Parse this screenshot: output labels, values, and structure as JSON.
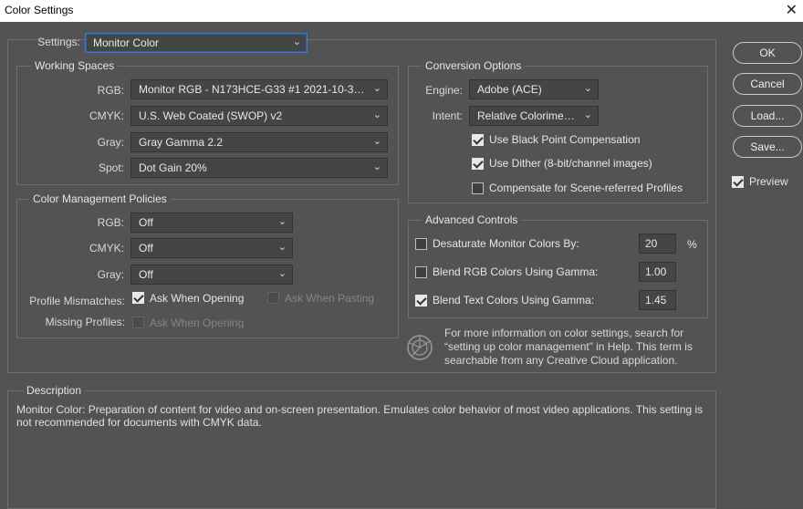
{
  "window": {
    "title": "Color Settings",
    "close_icon": "close-icon"
  },
  "settings": {
    "label": "Settings:",
    "value": "Monitor Color"
  },
  "working_spaces": {
    "title": "Working Spaces",
    "rgb": {
      "label": "RGB:",
      "value": "Monitor RGB - N173HCE-G33 #1 2021-10-31..."
    },
    "cmyk": {
      "label": "CMYK:",
      "value": "U.S. Web Coated (SWOP) v2"
    },
    "gray": {
      "label": "Gray:",
      "value": "Gray Gamma 2.2"
    },
    "spot": {
      "label": "Spot:",
      "value": "Dot Gain 20%"
    }
  },
  "policies": {
    "title": "Color Management Policies",
    "rgb": {
      "label": "RGB:",
      "value": "Off"
    },
    "cmyk": {
      "label": "CMYK:",
      "value": "Off"
    },
    "gray": {
      "label": "Gray:",
      "value": "Off"
    },
    "mismatches_label": "Profile Mismatches:",
    "ask_opening": {
      "label": "Ask When Opening",
      "checked": true
    },
    "ask_pasting": {
      "label": "Ask When Pasting",
      "checked": false,
      "disabled": true
    },
    "missing_label": "Missing Profiles:",
    "missing_ask_opening": {
      "label": "Ask When Opening",
      "checked": false,
      "disabled": true
    }
  },
  "conversion": {
    "title": "Conversion Options",
    "engine": {
      "label": "Engine:",
      "value": "Adobe (ACE)"
    },
    "intent": {
      "label": "Intent:",
      "value": "Relative Colorimetric"
    },
    "black_point": {
      "label": "Use Black Point Compensation",
      "checked": true
    },
    "dither": {
      "label": "Use Dither (8-bit/channel images)",
      "checked": true
    },
    "scene_referred": {
      "label": "Compensate for Scene-referred Profiles",
      "checked": false
    }
  },
  "advanced": {
    "title": "Advanced Controls",
    "desaturate": {
      "label": "Desaturate Monitor Colors By:",
      "checked": false,
      "value": "20",
      "unit": "%"
    },
    "blend_rgb": {
      "label": "Blend RGB Colors Using Gamma:",
      "checked": false,
      "value": "1.00"
    },
    "blend_text": {
      "label": "Blend Text Colors Using Gamma:",
      "checked": true,
      "value": "1.45"
    }
  },
  "info": {
    "icon": "color-wheel-icon",
    "text": "For more information on color settings, search for “setting up color management” in Help. This term is searchable from any Creative Cloud application."
  },
  "description": {
    "title": "Description",
    "text": "Monitor Color:  Preparation of content for video and on-screen presentation. Emulates color behavior of most video applications. This setting is not recommended for documents with CMYK data."
  },
  "buttons": {
    "ok": "OK",
    "cancel": "Cancel",
    "load": "Load...",
    "save": "Save..."
  },
  "preview": {
    "label": "Preview",
    "checked": true
  },
  "chevron": "⌄"
}
